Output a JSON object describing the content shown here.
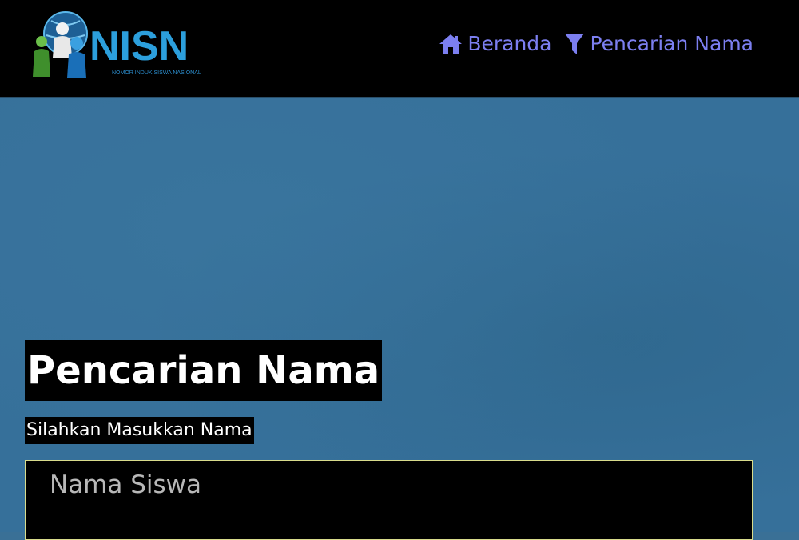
{
  "brand": {
    "name": "NISN",
    "tagline": "NOMOR INDUK SISWA NASIONAL",
    "logo_icon": "people-globe-logo"
  },
  "nav": {
    "items": [
      {
        "label": "Beranda",
        "icon": "home-icon"
      },
      {
        "label": "Pencarian Nama",
        "icon": "filter-icon"
      }
    ]
  },
  "main": {
    "title": "Pencarian Nama",
    "subtitle": "Silahkan Masukkan Nama",
    "search": {
      "placeholder": "Nama Siswa",
      "value": ""
    }
  },
  "colors": {
    "nav_background": "#000000",
    "hero_background": "#36709a",
    "nav_link": "#7c7ff0",
    "brand_blue": "#2c9fdc",
    "input_border": "#d9dc8c"
  }
}
